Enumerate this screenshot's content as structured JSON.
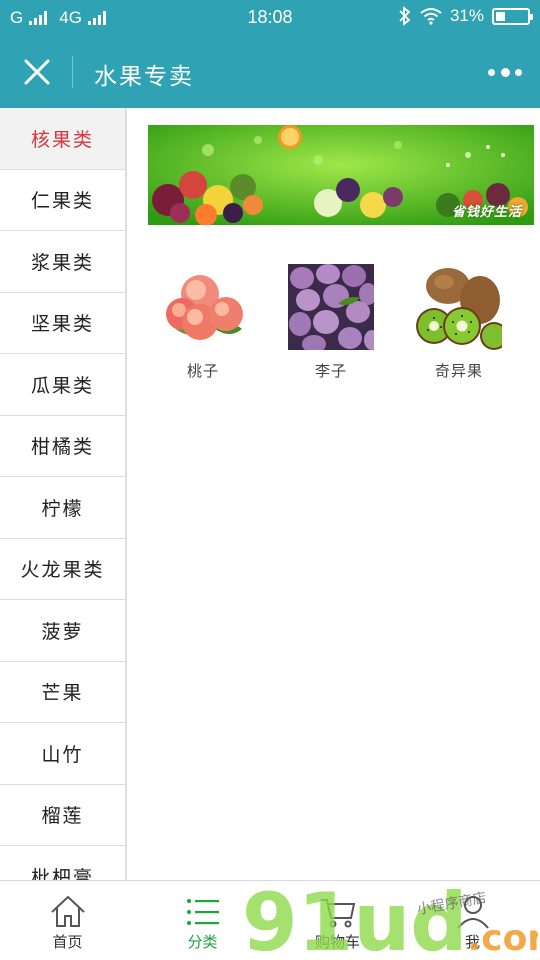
{
  "status_bar": {
    "carrier1": "G",
    "carrier2": "4G",
    "time": "18:08",
    "battery": "31%",
    "battery_level": 0.31
  },
  "nav": {
    "title": "水果专卖"
  },
  "sidebar": {
    "items": [
      {
        "label": "核果类",
        "active": true
      },
      {
        "label": "仁果类"
      },
      {
        "label": "浆果类"
      },
      {
        "label": "坚果类"
      },
      {
        "label": "瓜果类"
      },
      {
        "label": "柑橘类"
      },
      {
        "label": "柠檬"
      },
      {
        "label": "火龙果类"
      },
      {
        "label": "菠萝"
      },
      {
        "label": "芒果"
      },
      {
        "label": "山竹"
      },
      {
        "label": "榴莲"
      },
      {
        "label": "枇杷膏"
      }
    ]
  },
  "banner": {
    "slogan": "省钱好生活"
  },
  "products": [
    {
      "name": "桃子",
      "icon": "peach-image"
    },
    {
      "name": "李子",
      "icon": "plum-image"
    },
    {
      "name": "奇异果",
      "icon": "kiwi-image"
    }
  ],
  "tabbar": {
    "items": [
      {
        "label": "首页",
        "icon": "home-icon"
      },
      {
        "label": "分类",
        "icon": "list-icon",
        "active": true
      },
      {
        "label": "购物车",
        "icon": "cart-icon"
      },
      {
        "label": "我",
        "icon": "user-icon"
      }
    ]
  },
  "watermark": {
    "brand": "91ud.com",
    "tagline": "小程序商店"
  },
  "colors": {
    "theme": "#2fa3b3",
    "active_category": "#d9363e",
    "active_tab": "#1aa63b"
  }
}
